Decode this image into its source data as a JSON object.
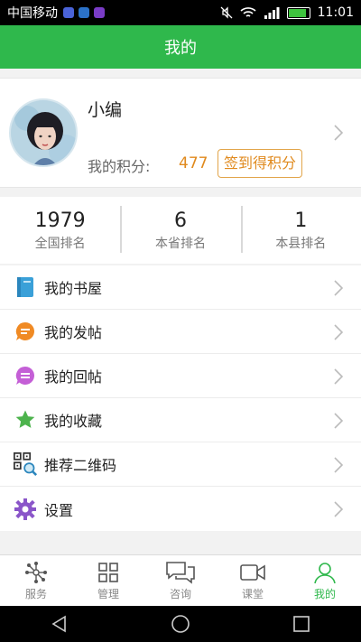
{
  "status_bar": {
    "carrier": "中国移动",
    "time": "11:01",
    "battery_level": 0.9
  },
  "header": {
    "title": "我的"
  },
  "profile": {
    "username": "小编",
    "points_label": "我的积分:",
    "points_value": "477",
    "checkin_button": "签到得积分"
  },
  "ranks": [
    {
      "value": "1979",
      "label": "全国排名"
    },
    {
      "value": "6",
      "label": "本省排名"
    },
    {
      "value": "1",
      "label": "本县排名"
    }
  ],
  "menu": [
    {
      "label": "我的书屋",
      "icon": "book-icon",
      "color": "#3aa0d8"
    },
    {
      "label": "我的发帖",
      "icon": "post-icon",
      "color": "#f08a24"
    },
    {
      "label": "我的回帖",
      "icon": "reply-icon",
      "color": "#c45fd6"
    },
    {
      "label": "我的收藏",
      "icon": "star-icon",
      "color": "#4db34d"
    },
    {
      "label": "推荐二维码",
      "icon": "qr-code-icon",
      "color": "#333333"
    },
    {
      "label": "设置",
      "icon": "gear-icon",
      "color": "#8a55c9"
    }
  ],
  "tabs": [
    {
      "label": "服务",
      "icon": "service-icon",
      "active": false
    },
    {
      "label": "管理",
      "icon": "grid-icon",
      "active": false
    },
    {
      "label": "咨询",
      "icon": "chat-icon",
      "active": false
    },
    {
      "label": "课堂",
      "icon": "video-icon",
      "active": false
    },
    {
      "label": "我的",
      "icon": "person-icon",
      "active": true
    }
  ],
  "colors": {
    "brand_green": "#2fb84c",
    "accent_orange": "#e08a1e"
  }
}
